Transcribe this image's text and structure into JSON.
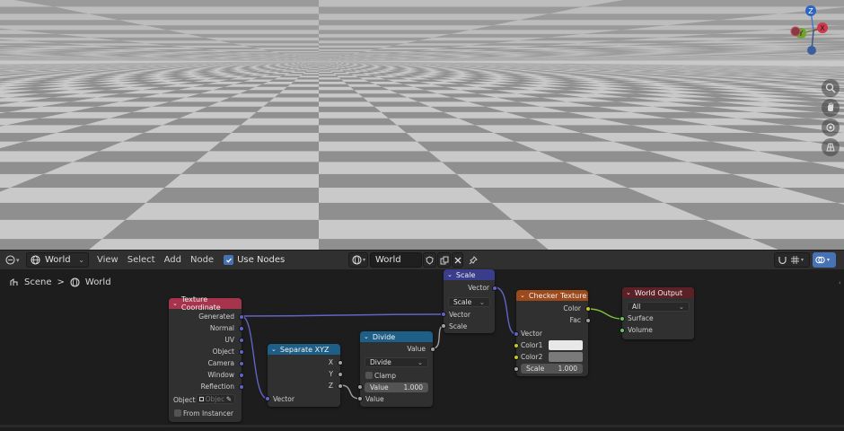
{
  "header": {
    "editor_type_icon": "node-editor-icon",
    "world_dropdown": "World",
    "menus": [
      "View",
      "Select",
      "Add",
      "Node"
    ],
    "use_nodes_label": "Use Nodes",
    "use_nodes_checked": true,
    "datablock_name": "World"
  },
  "breadcrumb": {
    "scene": "Scene",
    "separator": ">",
    "world": "World"
  },
  "nodes": {
    "texture_coordinate": {
      "title": "Texture Coordinate",
      "outputs": [
        "Generated",
        "Normal",
        "UV",
        "Object",
        "Camera",
        "Window",
        "Reflection"
      ],
      "object_label": "Object:",
      "object_placeholder": "Objec",
      "from_instancer": "From Instancer"
    },
    "separate_xyz": {
      "title": "Separate XYZ",
      "outputs": [
        "X",
        "Y",
        "Z"
      ],
      "input": "Vector"
    },
    "divide": {
      "title": "Divide",
      "output": "Value",
      "operation": "Divide",
      "clamp": "Clamp",
      "value_label": "Value",
      "value": "1.000",
      "input": "Value"
    },
    "scale": {
      "title": "Scale",
      "output": "Vector",
      "operation": "Scale",
      "input_vector": "Vector",
      "input_scale": "Scale"
    },
    "checker_texture": {
      "title": "Checker Texture",
      "out_color": "Color",
      "out_fac": "Fac",
      "in_vector": "Vector",
      "color1": "Color1",
      "color2": "Color2",
      "scale_label": "Scale",
      "scale_value": "1.000",
      "color1_hex": "#e8e8e8",
      "color2_hex": "#7a7a7a"
    },
    "world_output": {
      "title": "World Output",
      "target": "All",
      "surface": "Surface",
      "volume": "Volume"
    }
  },
  "gizmo": {
    "z": "Z",
    "y": "Y",
    "x": "X"
  },
  "colors": {
    "texture_coordinate_header": "#a7344d",
    "separate_xyz_header": "#1e5f87",
    "divide_header": "#1e5f87",
    "scale_header": "#3a3d8c",
    "checker_header": "#9c4a1b",
    "world_output_header": "#5c2126",
    "vector_socket": "#6363c7",
    "float_socket": "#a1a1a1",
    "color_socket": "#c7c729",
    "shader_socket": "#63c763"
  }
}
